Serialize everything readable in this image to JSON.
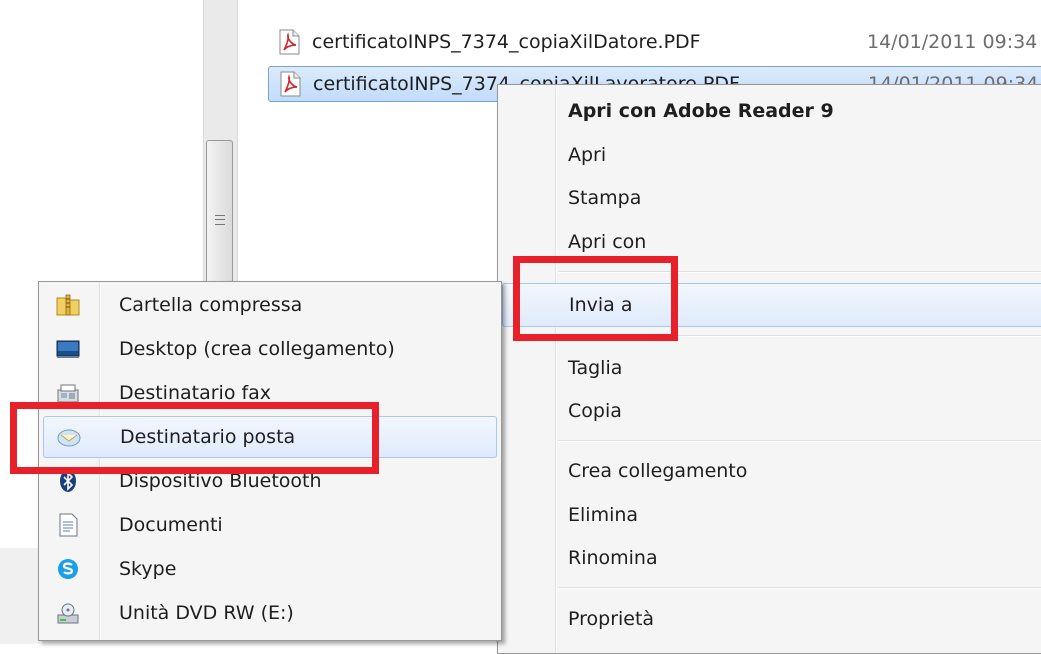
{
  "files": [
    {
      "name": "certificatoINPS_7374_copiaXilDatore.PDF",
      "date": "14/01/2011 09:34"
    },
    {
      "name": "certificatoINPS_7374_copiaXilLavoratore.PDF",
      "date": "14/01/2011 09:34"
    }
  ],
  "context_menu": {
    "items": [
      {
        "label": "Apri con Adobe Reader 9"
      },
      {
        "label": "Apri"
      },
      {
        "label": "Stampa"
      },
      {
        "label": "Apri con"
      },
      {
        "label": "Invia a"
      },
      {
        "label": "Taglia"
      },
      {
        "label": "Copia"
      },
      {
        "label": "Crea collegamento"
      },
      {
        "label": "Elimina"
      },
      {
        "label": "Rinomina"
      },
      {
        "label": "Proprietà"
      }
    ]
  },
  "send_to_menu": {
    "items": [
      {
        "label": "Cartella compressa",
        "icon": "zip-folder-icon"
      },
      {
        "label": "Desktop (crea collegamento)",
        "icon": "desktop-icon"
      },
      {
        "label": "Destinatario fax",
        "icon": "fax-icon"
      },
      {
        "label": "Destinatario posta",
        "icon": "mail-icon"
      },
      {
        "label": "Dispositivo Bluetooth",
        "icon": "bluetooth-icon"
      },
      {
        "label": "Documenti",
        "icon": "documents-icon"
      },
      {
        "label": "Skype",
        "icon": "skype-icon"
      },
      {
        "label": "Unità DVD RW (E:)",
        "icon": "dvd-drive-icon"
      }
    ]
  },
  "colors": {
    "highlight": "#e8202a",
    "hover": "#dfeafb",
    "selection": "#c1dcfc"
  }
}
